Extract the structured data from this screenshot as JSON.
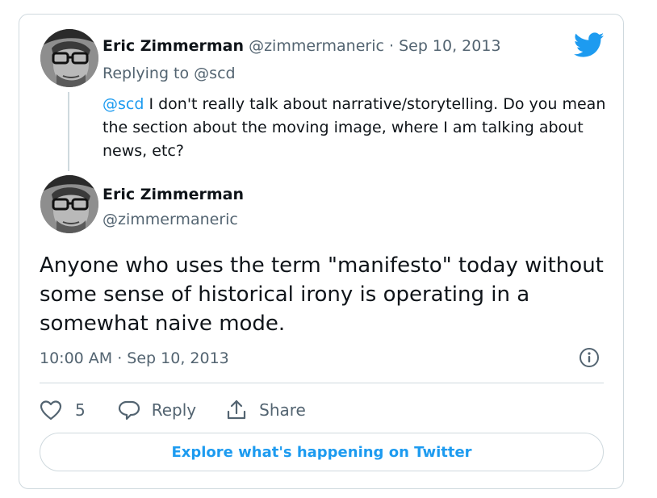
{
  "colors": {
    "accent": "#1d9bf0",
    "muted": "#536471",
    "border": "#cfd9de",
    "text": "#0f1419"
  },
  "reply_tweet": {
    "author_name": "Eric Zimmerman",
    "author_handle": "@zimmermaneric",
    "separator": "·",
    "date": "Sep 10, 2013",
    "replying_to_prefix": "Replying to",
    "replying_to_handle": "@scd",
    "mention": "@scd",
    "text": " I don't really talk about narrative/storytelling. Do you mean the section about the moving image, where I am talking about news, etc?"
  },
  "main_tweet": {
    "author_name": "Eric Zimmerman",
    "author_handle": "@zimmermaneric",
    "text": "Anyone who uses the term \"manifesto\" today without some sense of historical irony is operating in a somewhat naive mode.",
    "timestamp": "10:00 AM · Sep 10, 2013"
  },
  "actions": {
    "like_count": "5",
    "reply_label": "Reply",
    "share_label": "Share"
  },
  "explore_label": "Explore what's happening on Twitter",
  "icons": [
    "twitter-bird-icon",
    "info-icon",
    "heart-icon",
    "reply-bubble-icon",
    "share-icon"
  ]
}
